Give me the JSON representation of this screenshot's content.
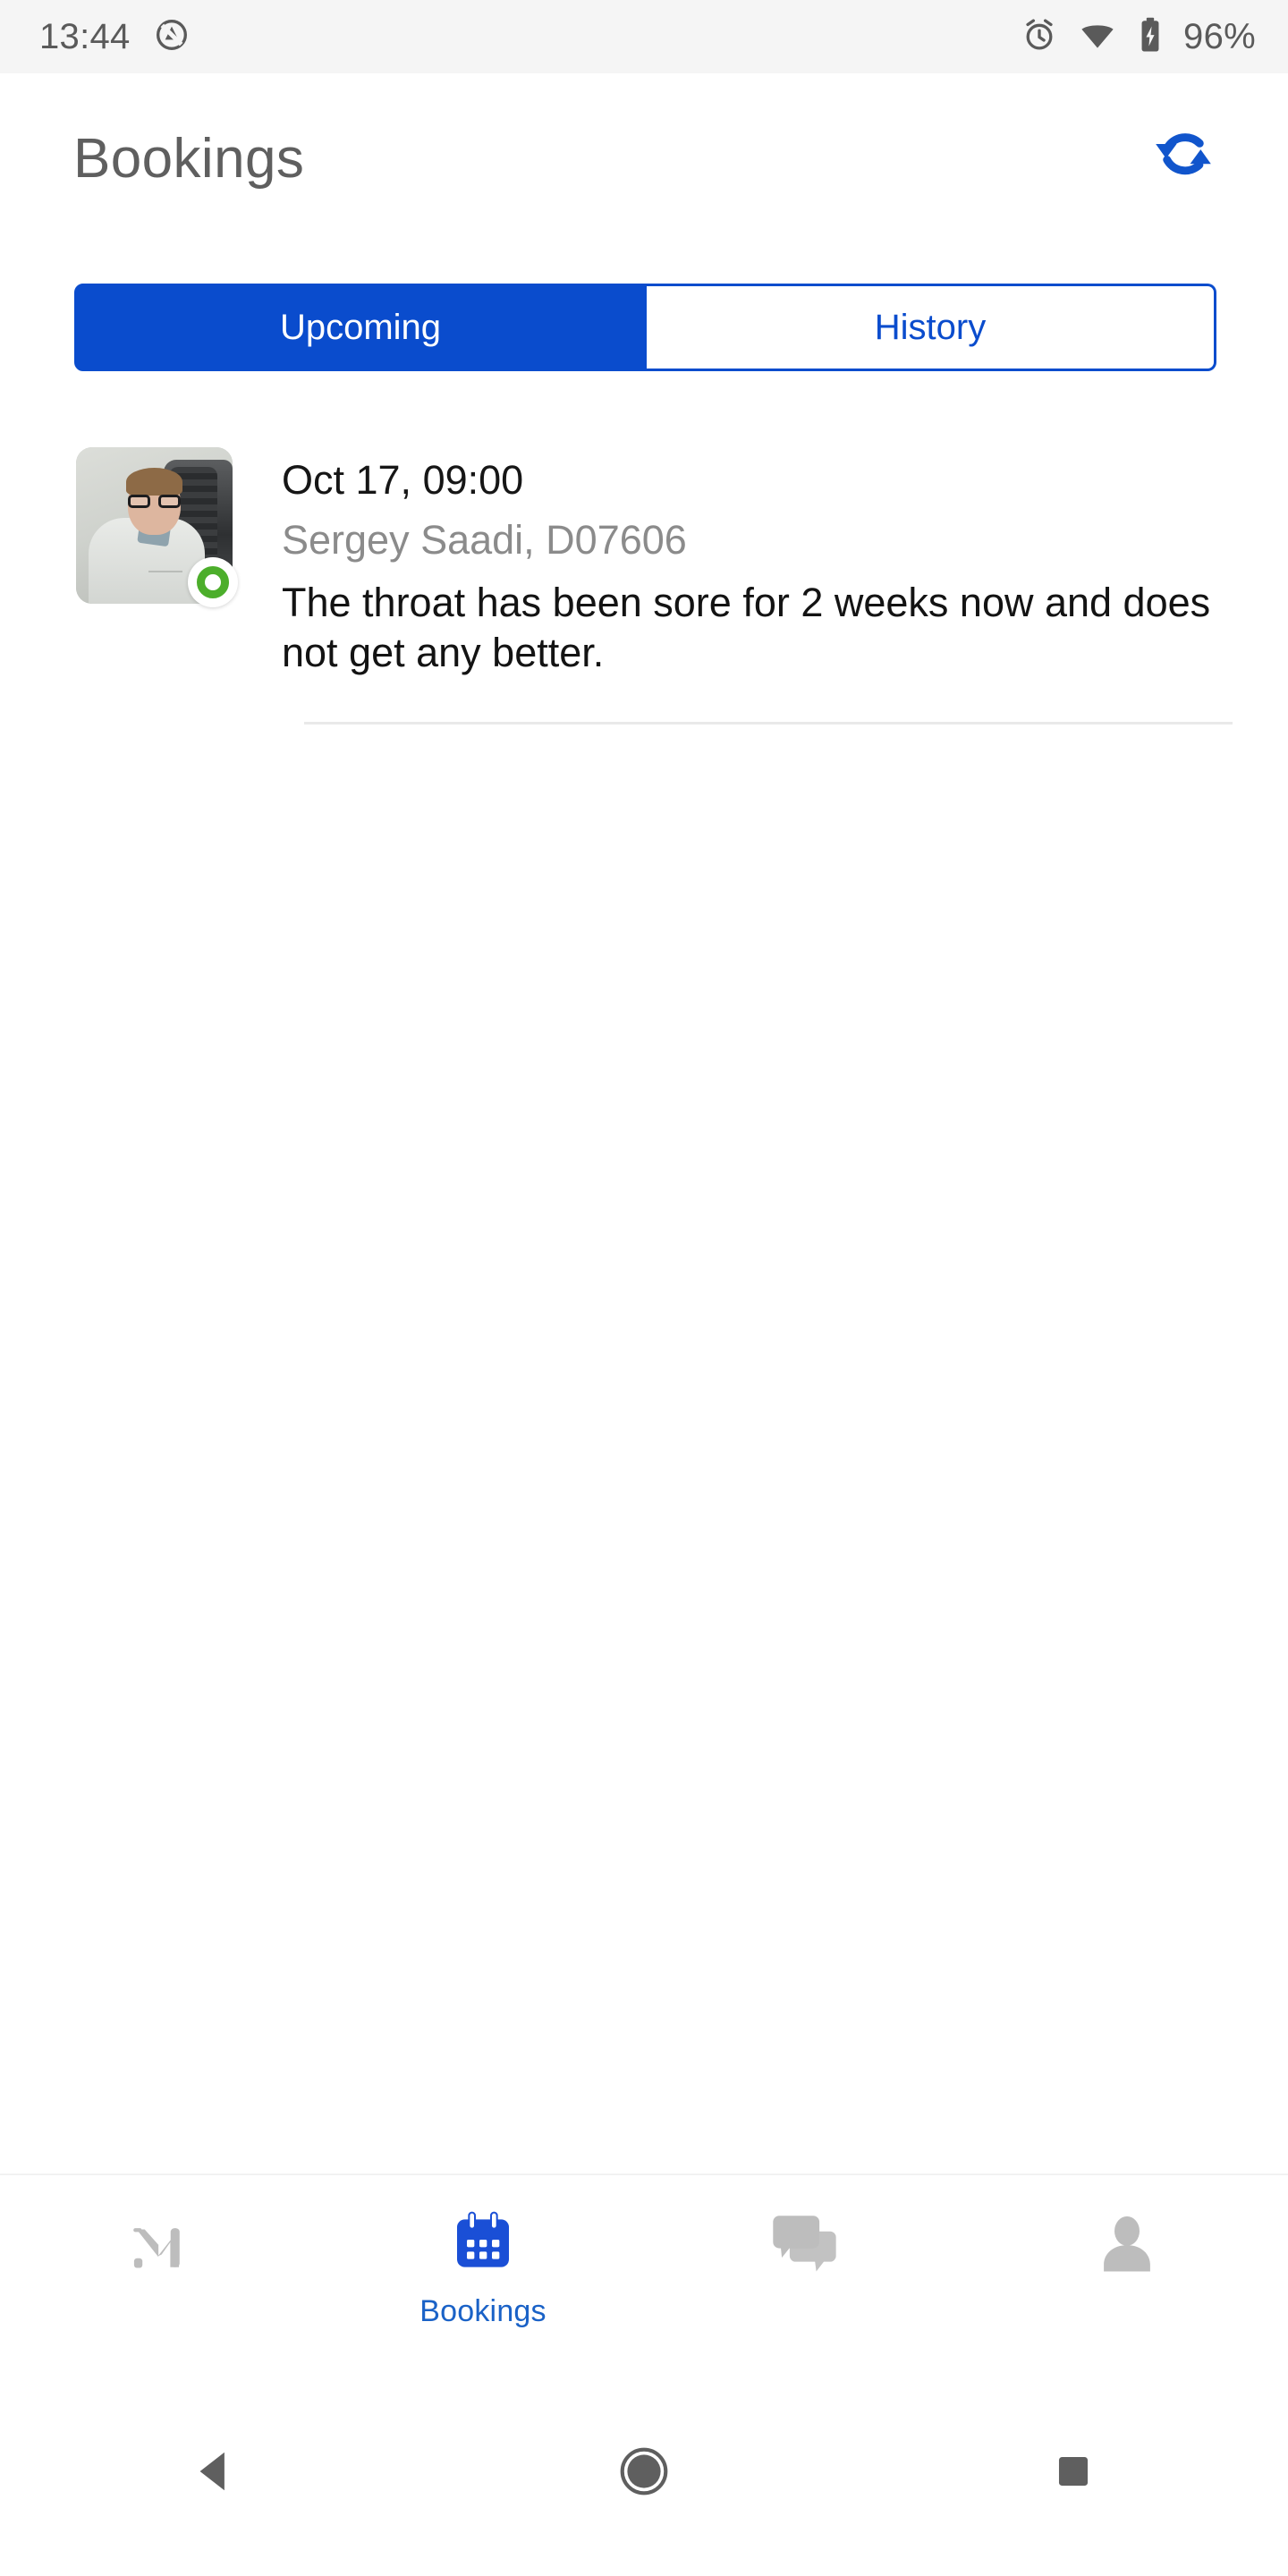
{
  "status_bar": {
    "time": "13:44",
    "notification_icon": "do-not-disturb-icon",
    "alarm_icon": "alarm-clock-icon",
    "wifi_icon": "wifi-icon",
    "battery_icon": "battery-charging-icon",
    "battery_text": "96%",
    "background_color": "#f5f5f5",
    "foreground_color": "#5a5a5a"
  },
  "app_bar": {
    "title": "Bookings",
    "refresh_icon": "sync-refresh-icon",
    "refresh_color": "#1155cc",
    "title_color": "#5f5f5f"
  },
  "tabs": {
    "active_index": 0,
    "accent_color": "#0a4ccd",
    "items": [
      {
        "label": "Upcoming",
        "selected": true
      },
      {
        "label": "History",
        "selected": false
      }
    ]
  },
  "bookings": [
    {
      "time": "Oct 17, 09:00",
      "doctor": "Sergey Saadi, D07606",
      "note": "The throat has been sore for 2 weeks now and does not get any better.",
      "avatar_alt": "doctor-photo",
      "presence": "online",
      "presence_color": "#4cae2b"
    }
  ],
  "bottom_nav": {
    "active_index": 1,
    "active_color": "#1a62c7",
    "inactive_color": "#bdbdbd",
    "items": [
      {
        "label": "",
        "icon": "medicloud-m-logo-icon",
        "selected": false
      },
      {
        "label": "Bookings",
        "icon": "calendar-icon",
        "selected": true
      },
      {
        "label": "",
        "icon": "chat-bubbles-icon",
        "selected": false
      },
      {
        "label": "",
        "icon": "person-icon",
        "selected": false
      }
    ]
  },
  "system_nav": {
    "back_icon": "back-triangle-icon",
    "home_icon": "home-circle-icon",
    "recents_icon": "recents-square-icon",
    "color": "#5f5f5f"
  }
}
